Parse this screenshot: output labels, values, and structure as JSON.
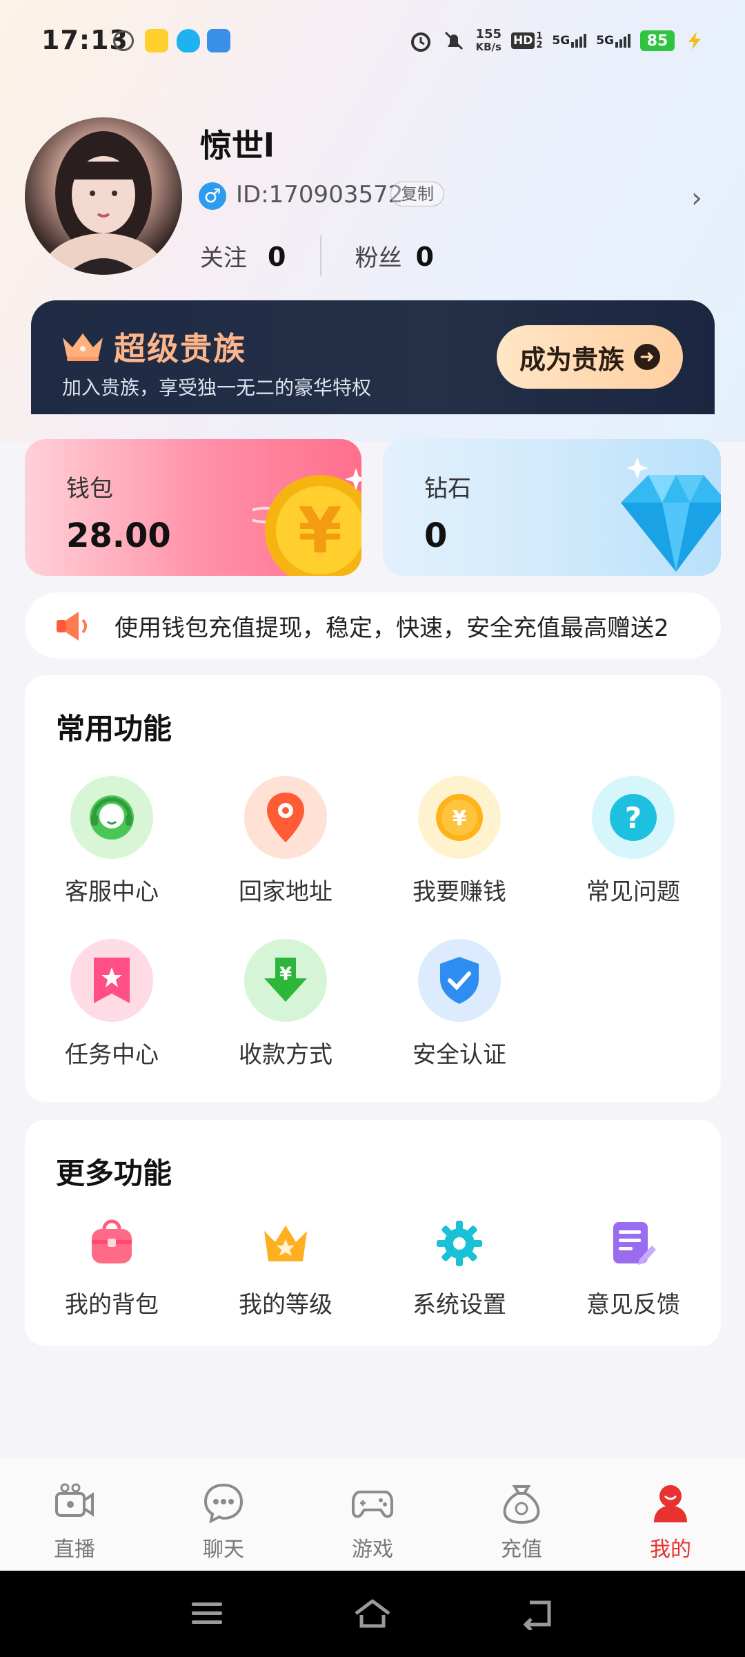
{
  "status_bar": {
    "time": "17:13",
    "net_speed_value": "155",
    "net_speed_unit": "KB/s",
    "hd_label": "HD",
    "sim1": "1",
    "sim2": "2",
    "signal1": "5G",
    "signal2": "5G",
    "battery": "85",
    "colors": {
      "battery": "#2ec43f"
    }
  },
  "profile": {
    "username": "惊世l",
    "user_id": "ID:170903572",
    "copy_label": "复制",
    "following_label": "关注",
    "following_count": "0",
    "fans_label": "粉丝",
    "fans_count": "0"
  },
  "vip": {
    "title": "超级贵族",
    "subtitle": "加入贵族，享受独一无二的豪华特权",
    "button_label": "成为贵族",
    "colors": {
      "title": "#ffb58a",
      "banner": "#1f2a44",
      "button": "#ffd9b0"
    }
  },
  "wallet": {
    "label": "钱包",
    "value": "28.00",
    "coin_symbol": "¥"
  },
  "diamond": {
    "label": "钻石",
    "value": "0"
  },
  "notice": {
    "text": "使用钱包充值提现，稳定，快速，安全充值最高赠送2"
  },
  "common_functions": {
    "title": "常用功能",
    "items": [
      {
        "label": "客服中心",
        "icon": "headset-icon",
        "bg": "#d8f5d6",
        "color": "#3fbf4a"
      },
      {
        "label": "回家地址",
        "icon": "location-pin-icon",
        "bg": "#ffe1d6",
        "color": "#ff6a3d"
      },
      {
        "label": "我要赚钱",
        "icon": "yen-coin-icon",
        "bg": "#fff3cf",
        "color": "#ffad1a"
      },
      {
        "label": "常见问题",
        "icon": "question-icon",
        "bg": "#d6f6fb",
        "color": "#1ec3e0"
      },
      {
        "label": "任务中心",
        "icon": "star-bookmark-icon",
        "bg": "#ffdbe6",
        "color": "#ff5a8c"
      },
      {
        "label": "收款方式",
        "icon": "download-yen-icon",
        "bg": "#d6f5d6",
        "color": "#2fb53a"
      },
      {
        "label": "安全认证",
        "icon": "shield-check-icon",
        "bg": "#dcebfd",
        "color": "#2e8df0"
      }
    ]
  },
  "more_functions": {
    "title": "更多功能",
    "items": [
      {
        "label": "我的背包",
        "icon": "backpack-icon",
        "color": "#ff5a7a"
      },
      {
        "label": "我的等级",
        "icon": "crown-star-icon",
        "color": "#ffb020"
      },
      {
        "label": "系统设置",
        "icon": "gear-icon",
        "color": "#19c1d6"
      },
      {
        "label": "意见反馈",
        "icon": "feedback-edit-icon",
        "color": "#9a6cf0"
      }
    ]
  },
  "bottom_nav": {
    "items": [
      {
        "label": "直播",
        "icon": "live-camera-icon"
      },
      {
        "label": "聊天",
        "icon": "chat-bubble-icon"
      },
      {
        "label": "游戏",
        "icon": "gamepad-icon"
      },
      {
        "label": "充值",
        "icon": "money-bag-icon"
      },
      {
        "label": "我的",
        "icon": "user-icon",
        "active": true
      }
    ],
    "colors": {
      "active": "#e8322f",
      "inactive": "#777777"
    }
  }
}
